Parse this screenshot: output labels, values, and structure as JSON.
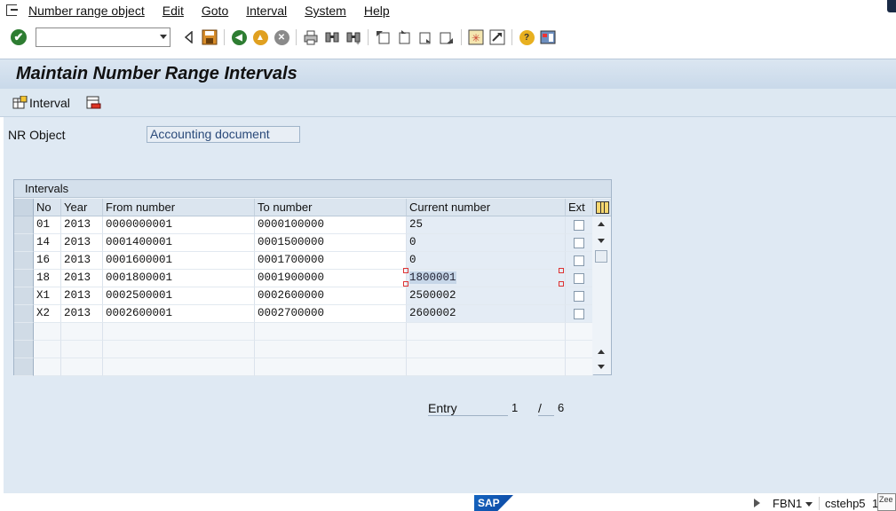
{
  "menubar": {
    "items": [
      {
        "label": "Number range object"
      },
      {
        "label": "Edit"
      },
      {
        "label": "Goto"
      },
      {
        "label": "Interval"
      },
      {
        "label": "System"
      },
      {
        "label": "Help"
      }
    ]
  },
  "toolbar": {
    "command_field_value": "",
    "icons": [
      "enter-icon",
      "back-icon",
      "save-icon",
      "back-nav-icon",
      "exit-icon",
      "cancel-icon",
      "print-icon",
      "find-icon",
      "find-next-icon",
      "first-page-icon",
      "prev-page-icon",
      "next-page-icon",
      "last-page-icon",
      "new-session-icon",
      "shortcut-icon",
      "help-icon",
      "layout-icon"
    ]
  },
  "page": {
    "title": "Maintain Number Range Intervals"
  },
  "app_toolbar": {
    "interval_label": "Interval"
  },
  "nr_object": {
    "label": "NR Object",
    "value": "Accounting document"
  },
  "intervals": {
    "title": "Intervals",
    "columns": [
      "No",
      "Year",
      "From number",
      "To number",
      "Current number",
      "Ext"
    ],
    "rows": [
      {
        "no": "01",
        "year": "2013",
        "from": "0000000001",
        "to": "0000100000",
        "current": "25",
        "ext": false
      },
      {
        "no": "14",
        "year": "2013",
        "from": "0001400001",
        "to": "0001500000",
        "current": "0",
        "ext": false
      },
      {
        "no": "16",
        "year": "2013",
        "from": "0001600001",
        "to": "0001700000",
        "current": "0",
        "ext": false
      },
      {
        "no": "18",
        "year": "2013",
        "from": "0001800001",
        "to": "0001900000",
        "current": "1800001",
        "ext": false
      },
      {
        "no": "X1",
        "year": "2013",
        "from": "0002500001",
        "to": "0002600000",
        "current": "2500002",
        "ext": false
      },
      {
        "no": "X2",
        "year": "2013",
        "from": "0002600001",
        "to": "0002700000",
        "current": "2600002",
        "ext": false
      }
    ]
  },
  "entry": {
    "label": "Entry",
    "current": "1",
    "separator": "/",
    "total": "6"
  },
  "statusbar": {
    "logo": "SAP",
    "transaction": "FBN1",
    "server": "cstehp5",
    "extra": "1",
    "tooltip": "Zee"
  }
}
